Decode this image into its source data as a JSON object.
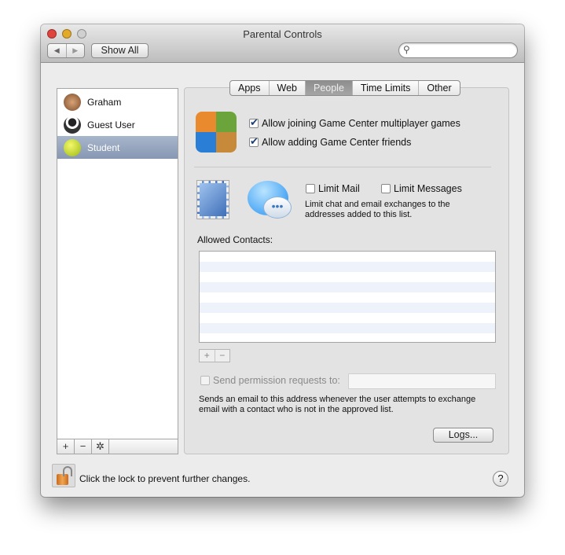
{
  "window": {
    "title": "Parental Controls"
  },
  "toolbar": {
    "back": "◀",
    "forward": "▶",
    "show_all": "Show All",
    "search_placeholder": ""
  },
  "users": [
    {
      "name": "Graham"
    },
    {
      "name": "Guest User"
    },
    {
      "name": "Student",
      "selected": true
    }
  ],
  "list_buttons": {
    "add": "+",
    "remove": "−",
    "gear": "✲"
  },
  "tabs": [
    {
      "label": "Apps"
    },
    {
      "label": "Web"
    },
    {
      "label": "People",
      "active": true
    },
    {
      "label": "Time Limits"
    },
    {
      "label": "Other"
    }
  ],
  "game_center": {
    "allow_multiplayer": {
      "label": "Allow joining Game Center multiplayer games",
      "checked": true
    },
    "allow_friends": {
      "label": "Allow adding Game Center friends",
      "checked": true
    }
  },
  "limits": {
    "limit_mail": {
      "label": "Limit Mail",
      "checked": false
    },
    "limit_messages": {
      "label": "Limit Messages",
      "checked": false
    },
    "description": "Limit chat and email exchanges to the addresses added to this list."
  },
  "allowed_contacts": {
    "label": "Allowed Contacts:",
    "items": [],
    "add": "+",
    "remove": "−"
  },
  "permission": {
    "label": "Send permission requests to:",
    "checked": false,
    "value": "",
    "description": "Sends an email to this address whenever the user attempts to exchange email with a contact who is not in the approved list."
  },
  "logs_button": "Logs...",
  "footer": {
    "lock_text": "Click the lock to prevent further changes.",
    "help": "?"
  },
  "colors": {
    "selection": "#8f9fb9",
    "checkbox_check": "#1f3e78"
  }
}
